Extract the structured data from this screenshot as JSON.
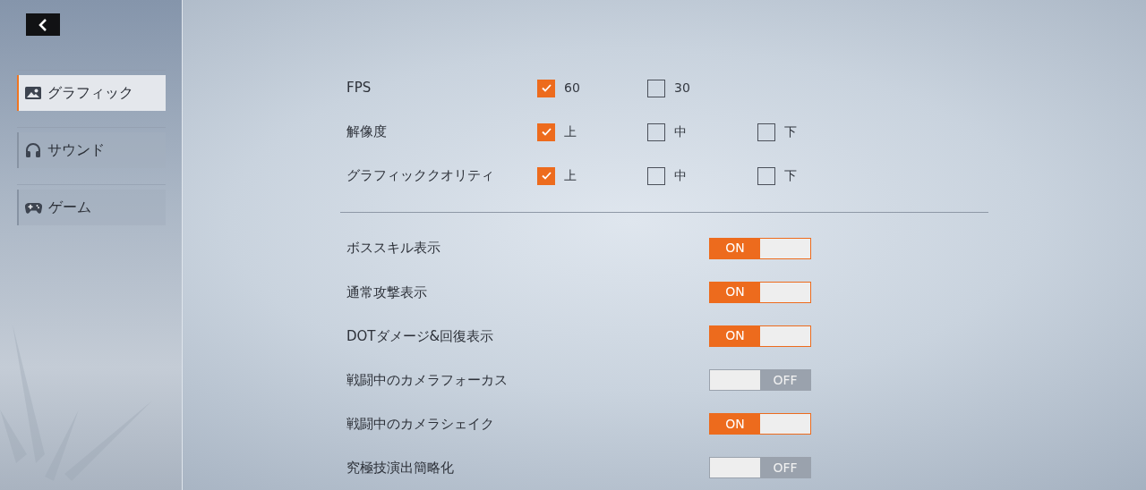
{
  "sidebar": {
    "items": [
      {
        "label": "グラフィック",
        "selected": true
      },
      {
        "label": "サウンド",
        "selected": false
      },
      {
        "label": "ゲーム",
        "selected": false
      }
    ]
  },
  "choice_settings": [
    {
      "label": "FPS",
      "options": [
        {
          "label": "60",
          "selected": true
        },
        {
          "label": "30",
          "selected": false
        }
      ]
    },
    {
      "label": "解像度",
      "options": [
        {
          "label": "上",
          "selected": true
        },
        {
          "label": "中",
          "selected": false
        },
        {
          "label": "下",
          "selected": false
        }
      ]
    },
    {
      "label": "グラフィッククオリティ",
      "options": [
        {
          "label": "上",
          "selected": true
        },
        {
          "label": "中",
          "selected": false
        },
        {
          "label": "下",
          "selected": false
        }
      ]
    }
  ],
  "toggle_settings": [
    {
      "label": "ボススキル表示",
      "on": true,
      "text": "ON"
    },
    {
      "label": "通常攻撃表示",
      "on": true,
      "text": "ON"
    },
    {
      "label": "DOTダメージ&回復表示",
      "on": true,
      "text": "ON"
    },
    {
      "label": "戦闘中のカメラフォーカス",
      "on": false,
      "text": "OFF"
    },
    {
      "label": "戦闘中のカメラシェイク",
      "on": true,
      "text": "ON"
    },
    {
      "label": "究極技演出簡略化",
      "on": false,
      "text": "OFF"
    }
  ]
}
